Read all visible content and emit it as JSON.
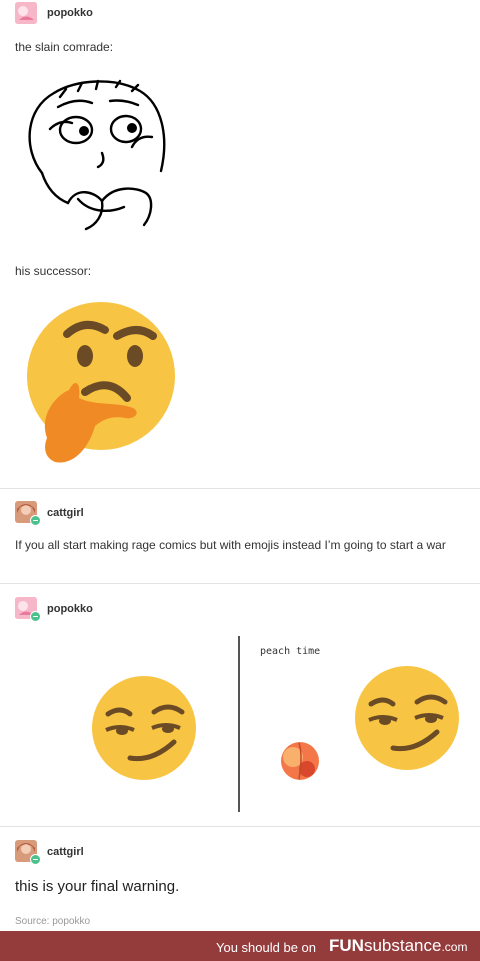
{
  "posts": [
    {
      "username": "popokko",
      "lines": [
        "the slain comrade:",
        "his successor:"
      ]
    },
    {
      "username": "cattgirl",
      "text": "If you all start making rage comics but with emojis instead I’m going to start a war"
    },
    {
      "username": "popokko",
      "meme_caption": "peach time"
    },
    {
      "username": "cattgirl",
      "text": "this is your final warning."
    }
  ],
  "source": "Source: popokko",
  "footer": {
    "prefix": "You should be on",
    "brand_bold": "FUN",
    "brand_rest": "substance",
    "brand_tld": ".com"
  },
  "colors": {
    "footer_bg": "#943c3c",
    "reblog_badge": "#4cc18b",
    "emoji_yellow": "#f7c543",
    "hand_orange": "#f08a24"
  }
}
